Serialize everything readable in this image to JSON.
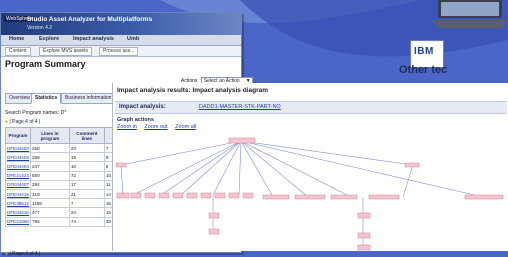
{
  "app": {
    "badge": "WebSphere",
    "title": "Studio Asset Analyzer for Multiplatforms",
    "version": "Version 4.2",
    "nav": [
      "Home",
      "Explore",
      "Impact analysis",
      "Umb"
    ],
    "subnav": [
      "Content",
      "Explore MVS assets",
      "Process ass..."
    ],
    "page_title": "Program Summary",
    "actions_label": "Actions",
    "actions_select": "Select an Action",
    "tabs": [
      "Overview",
      "Statistics",
      "Business information"
    ],
    "search_label": "Search Program names: D*",
    "pager": "| Page 4 of 4 |",
    "columns": [
      "Program",
      "Lines in program",
      "Comment lines"
    ],
    "rows": [
      [
        "DFE04402",
        "250",
        "23",
        "7"
      ],
      [
        "DFE04403",
        "289",
        "19",
        "8"
      ],
      [
        "DFE04404",
        "247",
        "18",
        "8"
      ],
      [
        "DFE21424",
        "550",
        "72",
        "10"
      ],
      [
        "DFE04407",
        "284",
        "17",
        "11"
      ],
      [
        "DFE04415",
        "319",
        "21",
        "14"
      ],
      [
        "DFE38612",
        "1159",
        "7",
        "16"
      ],
      [
        "DFE04416",
        "477",
        "24",
        "15"
      ],
      [
        "DFE21860",
        "786",
        "74",
        "33"
      ]
    ]
  },
  "impact": {
    "title": "Impact analysis results: Impact analysis diagram",
    "label": "Impact analysis:",
    "value": "DADD1-MASTER-STK-PART-NO",
    "graph_actions_title": "Graph actions",
    "graph_actions": [
      "Zoom in",
      "Zoom out",
      "Zoom all"
    ]
  },
  "decor": {
    "other_text": "Other tec",
    "ibm_logo": "IBM"
  },
  "colors": {
    "background": "#4a66c8",
    "header": "#233b7a",
    "link": "#1c3fb0",
    "node": "#f6c6d0"
  }
}
